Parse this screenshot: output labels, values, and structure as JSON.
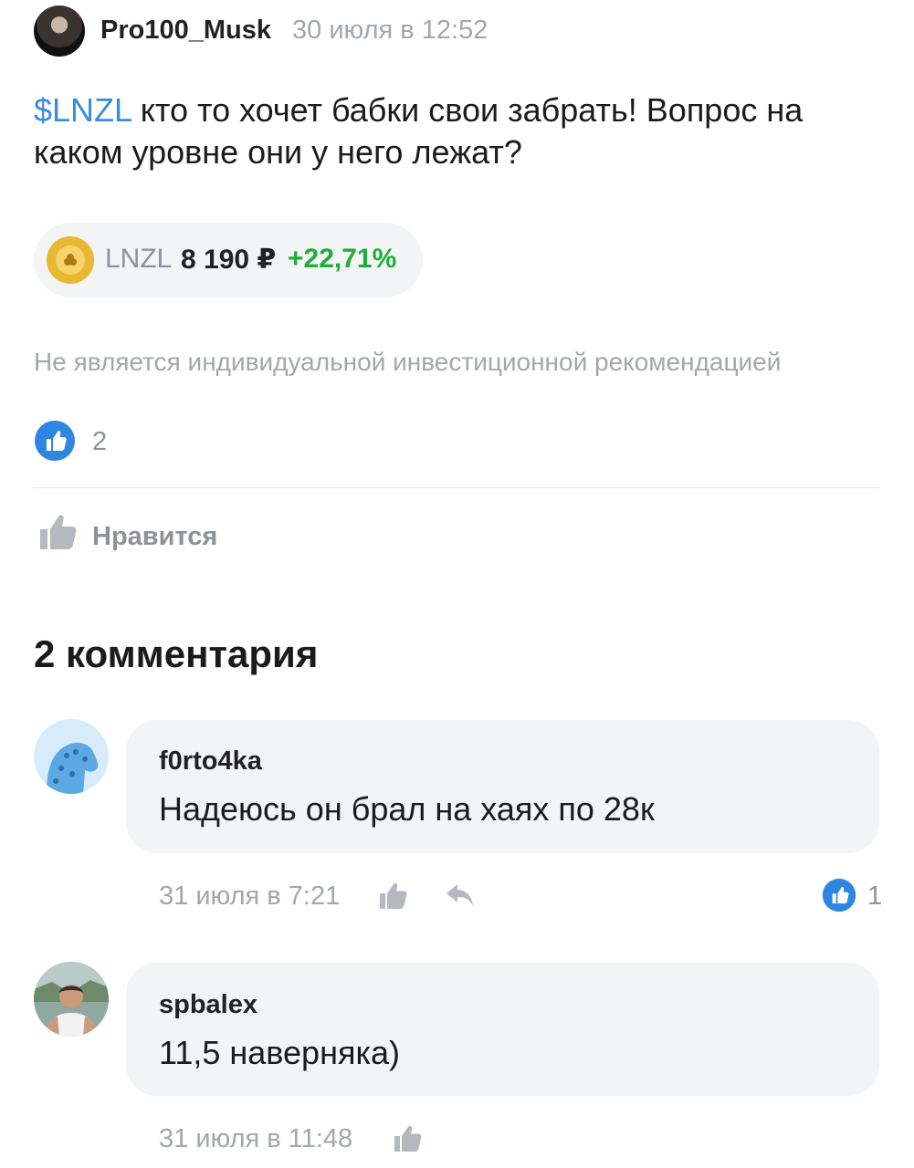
{
  "post": {
    "author": "Pro100_Musk",
    "time": "30 июля в 12:52",
    "ticker_link": "$LNZL",
    "text": " кто то хочет бабки свои забрать! Вопрос на каком уровне они у него лежат?",
    "disclaimer": "Не является индивидуальной инвестиционной рекомендацией",
    "reaction_count": "2",
    "like_label": "Нравится"
  },
  "ticker_chip": {
    "ticker": "LNZL",
    "price": "8 190 ₽",
    "change": "+22,71%"
  },
  "comments": {
    "title": "2 комментария",
    "items": [
      {
        "author": "f0rto4ka",
        "text": "Надеюсь он брал на хаях по 28к",
        "time": "31 июля в 7:21",
        "reaction_count": "1"
      },
      {
        "author": "spbalex",
        "text": "11,5 наверняка)",
        "time": "31 июля в 11:48"
      }
    ]
  },
  "colors": {
    "accent_blue": "#3a8dde",
    "positive_green": "#1fad3a",
    "muted_gray": "#a3a6ad",
    "bubble_bg": "#f3f4f6"
  }
}
